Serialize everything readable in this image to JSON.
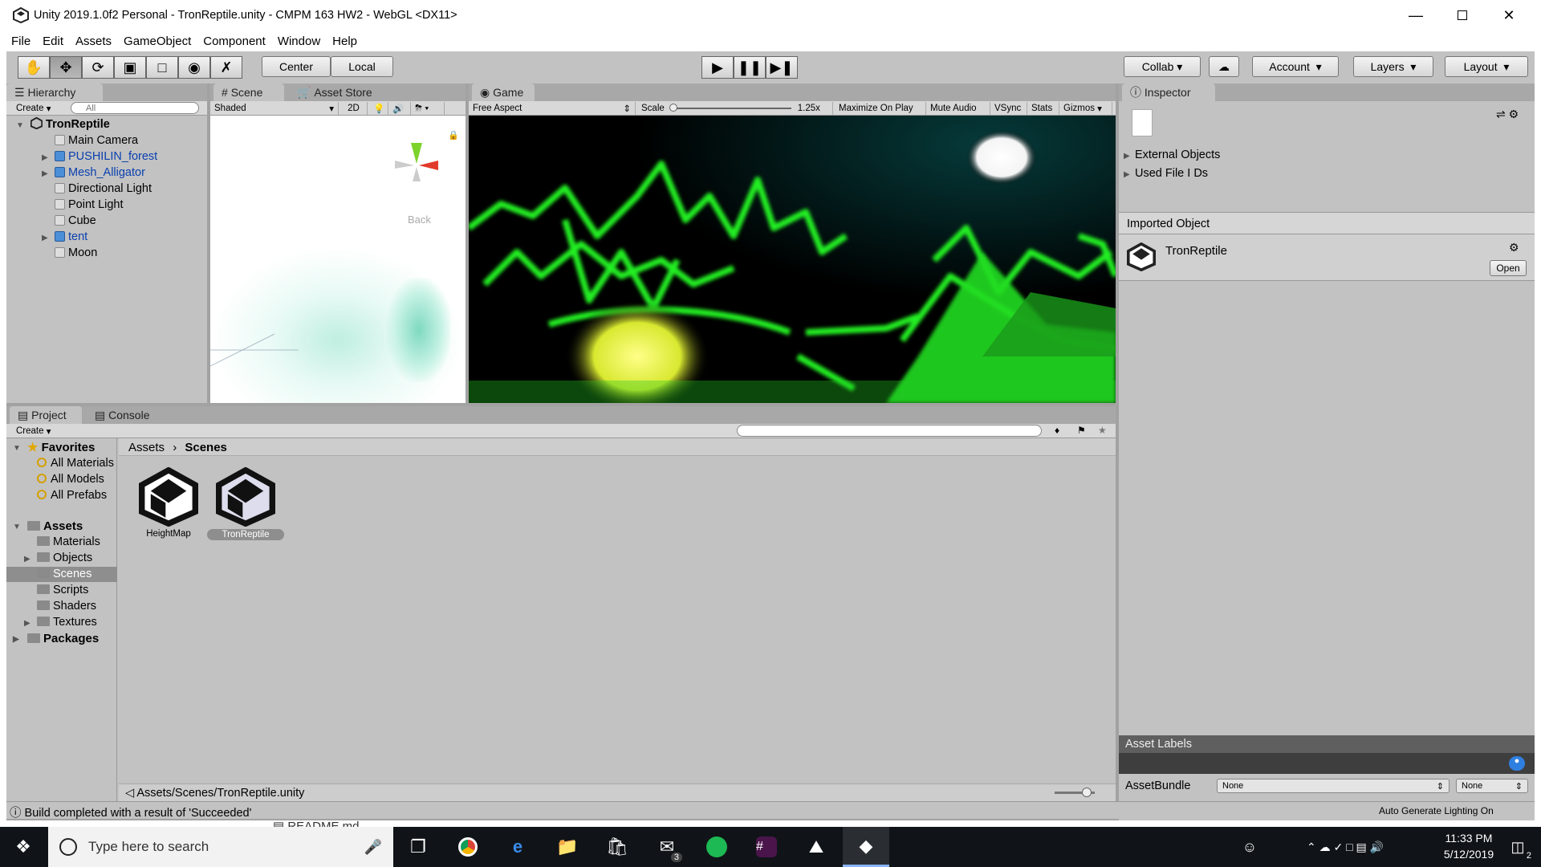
{
  "window": {
    "title": "Unity 2019.1.0f2 Personal - TronReptile.unity - CMPM 163 HW2 - WebGL <DX11>"
  },
  "menu": [
    "File",
    "Edit",
    "Assets",
    "GameObject",
    "Component",
    "Window",
    "Help"
  ],
  "toolbar": {
    "center_label": "Center",
    "local_label": "Local",
    "collab_label": "Collab",
    "account_label": "Account",
    "layers_label": "Layers",
    "layout_label": "Layout"
  },
  "hierarchy": {
    "tab": "Hierarchy",
    "create": "Create",
    "search_placeholder": "All",
    "root": "TronReptile",
    "items": [
      {
        "label": "Main Camera",
        "prefab": false,
        "expandable": false
      },
      {
        "label": "PUSHILIN_forest",
        "prefab": true,
        "expandable": true
      },
      {
        "label": "Mesh_Alligator",
        "prefab": true,
        "expandable": true
      },
      {
        "label": "Directional Light",
        "prefab": false,
        "expandable": false
      },
      {
        "label": "Point Light",
        "prefab": false,
        "expandable": false
      },
      {
        "label": "Cube",
        "prefab": false,
        "expandable": false
      },
      {
        "label": "tent",
        "prefab": true,
        "expandable": true
      },
      {
        "label": "Moon",
        "prefab": false,
        "expandable": false
      }
    ]
  },
  "scene": {
    "tab_scene": "Scene",
    "tab_store": "Asset Store",
    "shading": "Shaded",
    "mode_2d": "2D",
    "gizmo_label": "Back"
  },
  "game": {
    "tab": "Game",
    "aspect": "Free Aspect",
    "scale_label": "Scale",
    "scale_value": "1.25x",
    "maximize": "Maximize On Play",
    "mute": "Mute Audio",
    "vsync": "VSync",
    "stats": "Stats",
    "gizmos": "Gizmos"
  },
  "inspector": {
    "tab": "Inspector",
    "items": [
      "External Objects",
      "Used File I Ds"
    ],
    "imported_header": "Imported Object",
    "object_name": "TronReptile",
    "open_button": "Open",
    "asset_labels": "Asset Labels",
    "assetbundle_label": "AssetBundle",
    "assetbundle_value": "None",
    "variant_value": "None"
  },
  "project": {
    "tab_project": "Project",
    "tab_console": "Console",
    "create": "Create",
    "favorites": "Favorites",
    "favorite_items": [
      "All Materials",
      "All Models",
      "All Prefabs"
    ],
    "assets_root": "Assets",
    "asset_folders": [
      {
        "label": "Materials",
        "expandable": false
      },
      {
        "label": "Objects",
        "expandable": true
      },
      {
        "label": "Scenes",
        "expandable": false,
        "selected": true
      },
      {
        "label": "Scripts",
        "expandable": false
      },
      {
        "label": "Shaders",
        "expandable": false
      },
      {
        "label": "Textures",
        "expandable": true
      }
    ],
    "packages": "Packages",
    "breadcrumb": [
      "Assets",
      "Scenes"
    ],
    "files": [
      "HeightMap",
      "TronReptile"
    ],
    "selected_path": "Assets/Scenes/TronReptile.unity"
  },
  "status": {
    "message": "Build completed with a result of 'Succeeded'",
    "lighting": "Auto Generate Lighting On",
    "behind_window": "README.md"
  },
  "taskbar": {
    "search_placeholder": "Type here to search",
    "time": "11:33 PM",
    "date": "5/12/2019",
    "mail_badge": "3",
    "notif_badge": "2"
  },
  "colors": {
    "game_glow": "#22ee22",
    "unity_panel": "#c2c2c2",
    "selection": "#8e8e8e"
  }
}
